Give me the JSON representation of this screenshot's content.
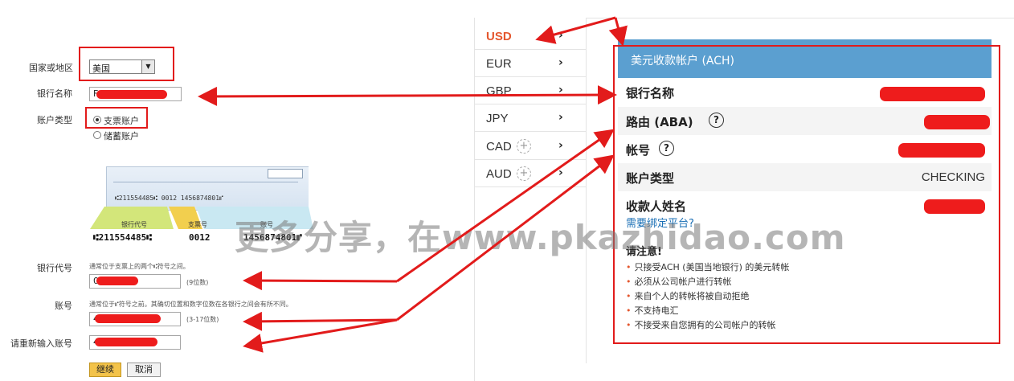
{
  "form": {
    "country_label": "国家或地区",
    "country_value": "美国",
    "bank_name_label": "银行名称",
    "bank_name_value": "F",
    "account_type_label": "账户类型",
    "account_type_options": [
      "支票账户",
      "储蓄账户"
    ],
    "routing_label": "银行代号",
    "routing_hint": "通常位于支票上的两个⑆符号之间。",
    "routing_value": "0",
    "routing_note": "(9位数)",
    "account_label": "账号",
    "account_hint": "通常位于⑈符号之前。其确切位置和数字位数在各银行之间会有所不同。",
    "account_value": "4",
    "account_note": "(3-17位数)",
    "reenter_label": "请重新输入账号",
    "reenter_value": "4",
    "continue_button": "继续",
    "cancel_button": "取消"
  },
  "check_image": {
    "micr_small": "⑆211554485⑆  0012  1456874801⑈",
    "strip_routing": "银行代号",
    "strip_check": "支票号",
    "strip_account": "账号",
    "micr_large_routing": "⑆211554485⑆",
    "micr_large_check": "0012",
    "micr_large_account": "1456874801⑈"
  },
  "currencies": [
    {
      "code": "USD",
      "active": true,
      "plus": false
    },
    {
      "code": "EUR",
      "active": false,
      "plus": false
    },
    {
      "code": "GBP",
      "active": false,
      "plus": false
    },
    {
      "code": "JPY",
      "active": false,
      "plus": false
    },
    {
      "code": "CAD",
      "active": false,
      "plus": true
    },
    {
      "code": "AUD",
      "active": false,
      "plus": true
    }
  ],
  "panel": {
    "title": "美元收款帐户 (ACH)",
    "bank_name_key": "银行名称",
    "routing_key": "路由 (ABA)",
    "account_key": "帐号",
    "account_type_key": "账户类型",
    "account_type_value": "CHECKING",
    "payee_key": "收款人姓名",
    "link_text": "需要绑定平台?",
    "notice_title": "请注意!",
    "notices": [
      "只接受ACH (美国当地银行) 的美元转帐",
      "必须从公司帐户进行转帐",
      "来自个人的转帐将被自动拒绝",
      "不支持电汇",
      "不接受来自您拥有的公司帐户的转帐"
    ]
  },
  "watermark": "更多分享，在www.pkazhidao.com",
  "colors": {
    "annotation_red": "#e21b1b",
    "header_blue": "#5b9fd0",
    "active_orange": "#e4572e",
    "link_blue": "#1a6fb5",
    "continue_yellow": "#f3c34a"
  }
}
